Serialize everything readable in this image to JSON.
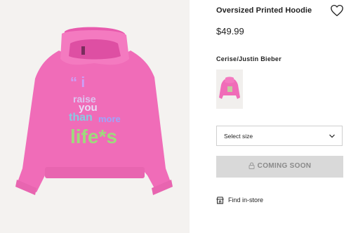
{
  "product": {
    "title": "Oversized Printed Hoodie",
    "price": "$49.99",
    "color_name": "Cerise/Justin Bieber",
    "print_text": [
      "“ i",
      "raise",
      "you",
      "more",
      "than",
      "life*s"
    ]
  },
  "controls": {
    "size_placeholder": "Select size",
    "coming_soon_label": "COMING SOON",
    "find_in_store_label": "Find in-store"
  },
  "colors": {
    "hoodie": "#f06cb8",
    "button_bg": "#d9d9d9",
    "button_text": "#8a8a8a"
  },
  "icons": [
    "heart-icon",
    "chevron-down-icon",
    "lock-icon",
    "store-icon"
  ]
}
